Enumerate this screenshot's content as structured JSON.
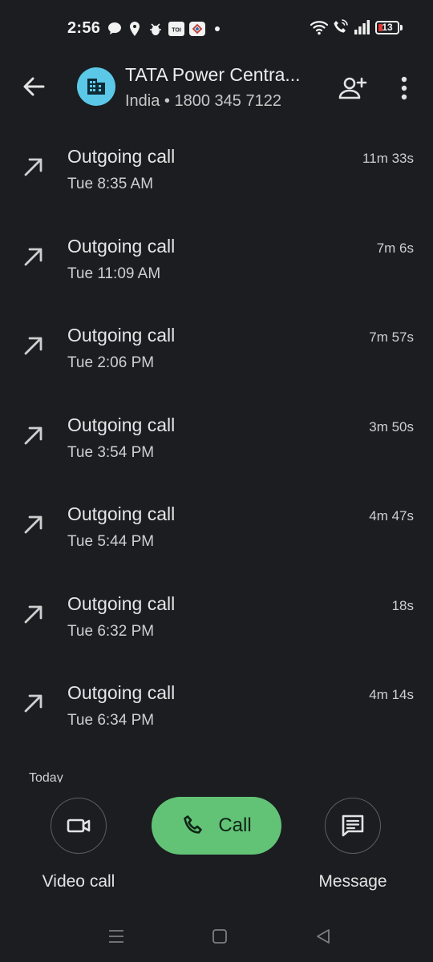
{
  "status_bar": {
    "time": "2:56",
    "battery_level": "13",
    "battery_color": "#e53935",
    "notification_icons": [
      "chat-bubble-icon",
      "location-pin-icon",
      "bug-icon",
      "toi-app-icon",
      "app-badge-icon",
      "dot-icon"
    ],
    "status_icons": [
      "wifi-icon",
      "wifi-calling-icon",
      "signal-icon",
      "battery-icon"
    ]
  },
  "header": {
    "contact_name": "TATA Power Centra...",
    "contact_sub": "India • 1800 345 7122",
    "avatar_color": "#5bc8e8",
    "avatar_icon": "building-icon"
  },
  "calls": [
    {
      "type": "Outgoing call",
      "time": "Tue 8:35 AM",
      "duration": "11m 33s"
    },
    {
      "type": "Outgoing call",
      "time": "Tue 11:09 AM",
      "duration": "7m 6s"
    },
    {
      "type": "Outgoing call",
      "time": "Tue 2:06 PM",
      "duration": "7m 57s"
    },
    {
      "type": "Outgoing call",
      "time": "Tue 3:54 PM",
      "duration": "3m 50s"
    },
    {
      "type": "Outgoing call",
      "time": "Tue 5:44 PM",
      "duration": "4m 47s"
    },
    {
      "type": "Outgoing call",
      "time": "Tue 6:32 PM",
      "duration": "18s"
    },
    {
      "type": "Outgoing call",
      "time": "Tue 6:34 PM",
      "duration": "4m 14s"
    }
  ],
  "section_label": "Today",
  "actions": {
    "video_call_label": "Video call",
    "call_label": "Call",
    "message_label": "Message",
    "call_button_color": "#62c377"
  }
}
